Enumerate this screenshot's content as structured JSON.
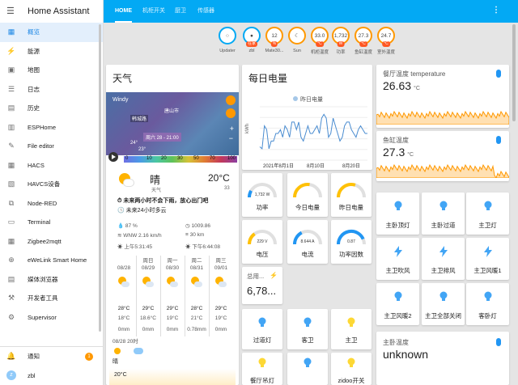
{
  "app": {
    "title": "Home Assistant"
  },
  "sidebar": {
    "items": [
      {
        "label": "概览",
        "icon": "dashboard-icon",
        "active": true
      },
      {
        "label": "能源",
        "icon": "lightning-icon"
      },
      {
        "label": "地图",
        "icon": "map-icon"
      },
      {
        "label": "日志",
        "icon": "logbook-icon"
      },
      {
        "label": "历史",
        "icon": "history-icon"
      },
      {
        "label": "ESPHome",
        "icon": "esphome-icon"
      },
      {
        "label": "File editor",
        "icon": "wrench-icon"
      },
      {
        "label": "HACS",
        "icon": "hacs-icon"
      },
      {
        "label": "HAVCS设备",
        "icon": "havcs-icon"
      },
      {
        "label": "Node-RED",
        "icon": "sitemap-icon"
      },
      {
        "label": "Terminal",
        "icon": "terminal-icon"
      },
      {
        "label": "Zigbee2mqtt",
        "icon": "zigbee-icon"
      },
      {
        "label": "eWeLink Smart Home",
        "icon": "globe-icon"
      },
      {
        "label": "媒体浏览器",
        "icon": "media-icon"
      },
      {
        "label": "开发者工具",
        "icon": "hammer-icon"
      },
      {
        "label": "Supervisor",
        "icon": "supervisor-icon"
      }
    ],
    "notifications": {
      "label": "通知",
      "count": "1"
    },
    "user": {
      "label": "zbl",
      "initial": "z"
    }
  },
  "tabs": [
    "HOME",
    "机柜开关",
    "厨卫",
    "传感器"
  ],
  "badges": [
    {
      "value": "",
      "name": "Updater",
      "unit": "",
      "icon": "circle-icon"
    },
    {
      "value": "",
      "name": "zbl",
      "unit": "在家",
      "icon": "person-icon"
    },
    {
      "value": "12",
      "name": "Mate30...",
      "unit": "%"
    },
    {
      "value": "",
      "name": "Sun",
      "unit": "",
      "icon": "moon-icon"
    },
    {
      "value": "33.0",
      "name": "机柜温度",
      "unit": "°C"
    },
    {
      "value": "1,732",
      "name": "功率",
      "unit": "W"
    },
    {
      "value": "27.3",
      "name": "鱼缸温度",
      "unit": "°C"
    },
    {
      "value": "24.7",
      "name": "室外温度",
      "unit": "°C"
    }
  ],
  "weather_card": {
    "title": "天气",
    "map_brand": "Windy",
    "map_city1": "韩城路",
    "map_city2": "唐山市",
    "map_time": "周六 28 - 21:00",
    "map_temp1": "24°",
    "map_temp2": "23°",
    "speed_unit": "km/h",
    "speed_scale": [
      "0",
      "10",
      "20",
      "30",
      "50",
      "70",
      "100"
    ],
    "condition": "晴",
    "condition_sub": "天气",
    "temperature": "20°C",
    "temp_side": "33",
    "alert1": "未来两小时不会下雨，放心出门吧",
    "alert2": "未来24小时多云",
    "humidity": "87 %",
    "pressure": "1009.86",
    "wind": "WNW 2.16 km/h",
    "visibility": "30 km",
    "sunrise": "上午5:31:45",
    "sunset": "下午6:44:08",
    "forecast": [
      {
        "day": "",
        "date": "08/28",
        "hi": "28°C",
        "lo": "18°C",
        "rain": "0mm"
      },
      {
        "day": "周日",
        "date": "08/29",
        "hi": "29°C",
        "lo": "18.6°C",
        "rain": "0mm"
      },
      {
        "day": "周一",
        "date": "08/30",
        "hi": "29°C",
        "lo": "19°C",
        "rain": "0mm"
      },
      {
        "day": "周二",
        "date": "08/31",
        "hi": "28°C",
        "lo": "21°C",
        "rain": "0.78mm"
      },
      {
        "day": "周三",
        "date": "09/01",
        "hi": "29°C",
        "lo": "19°C",
        "rain": "0mm"
      }
    ],
    "hourly_title": "08/28 20时",
    "hourly_cond": "晴",
    "hourly_temp": "20°C"
  },
  "energy_card": {
    "title": "每日电量",
    "legend": "昨日电量",
    "ylabel": "kWh",
    "xlabels": [
      "2021年8月1日",
      "8月10日",
      "8月20日"
    ]
  },
  "chart_data": {
    "type": "line",
    "series": [
      {
        "name": "昨日电量",
        "values": [
          3.5,
          3,
          9,
          8,
          3,
          5,
          5,
          7,
          7,
          8,
          6,
          9,
          8,
          6,
          10,
          10,
          8,
          10,
          6,
          5,
          7,
          9,
          7,
          7,
          8,
          9,
          7,
          11,
          12,
          11,
          6,
          7,
          11,
          9,
          7,
          5,
          6,
          9,
          10,
          10,
          8,
          7,
          6,
          8,
          9,
          8,
          7,
          7
        ]
      }
    ],
    "xlabels": [
      "2021年8月1日",
      "8月10日",
      "8月20日"
    ],
    "ylabel": "kWh"
  },
  "gauges": [
    {
      "label": "功率",
      "value": "1,732 W",
      "color": "#2196f3",
      "fraction": 0.17
    },
    {
      "label": "今日电量",
      "value": "",
      "color": "#ffc107",
      "fraction": 0.55
    },
    {
      "label": "昨日电量",
      "value": "",
      "color": "#ffc107",
      "fraction": 0.6
    },
    {
      "label": "电压",
      "value": "229 V",
      "color": "#ffc107",
      "fraction": 0.3
    },
    {
      "label": "电流",
      "value": "8.644 A",
      "color": "#2196f3",
      "fraction": 0.35
    },
    {
      "label": "功率因数",
      "value": "0.87",
      "color": "#2196f3",
      "fraction": 0.87
    }
  ],
  "total_card": {
    "title": "总用...",
    "value": "6,78..."
  },
  "light_tiles_mid": [
    "过道灯",
    "客卫",
    "主卫"
  ],
  "light_tiles_mid2": [
    "餐厅吊灯",
    "",
    "zidoo开关"
  ],
  "temp_cards": [
    {
      "name": "餐厅温度 temperature",
      "value": "26.63",
      "unit": "°C"
    },
    {
      "name": "鱼缸温度",
      "value": "27.3",
      "unit": "°C"
    }
  ],
  "right_tiles": [
    "主卧顶灯",
    "主卧过道",
    "主卫灯",
    "主卫吹风",
    "主卫排风",
    "主卫风暖1",
    "主卫风暖2",
    "主卫全部关闭",
    "客卧灯"
  ],
  "master_card": {
    "name": "主卧温度",
    "value": "unknown"
  }
}
